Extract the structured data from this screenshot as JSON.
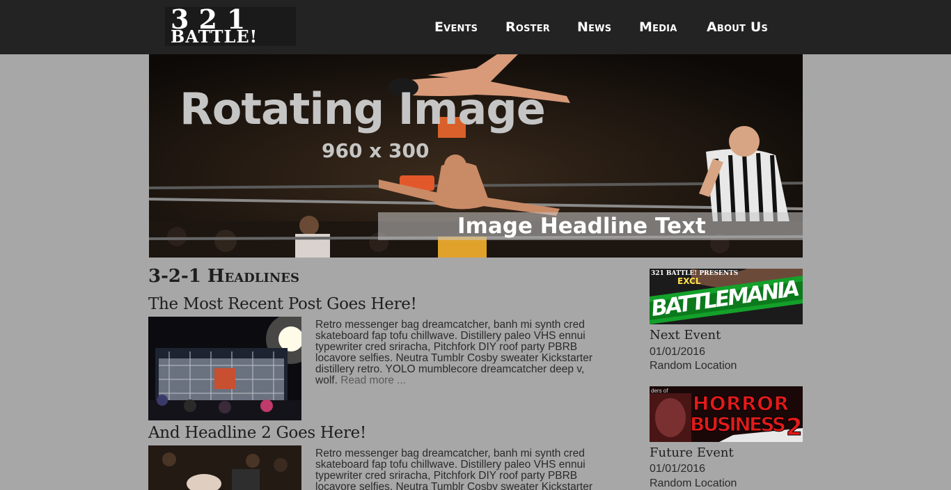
{
  "logo": {
    "line1": "321",
    "line2": "BATTLE!"
  },
  "nav": {
    "items": [
      "Events",
      "Roster",
      "News",
      "Media",
      "About Us"
    ]
  },
  "hero": {
    "title": "Rotating Image",
    "size_text": "960 x 300",
    "caption": "Image Headline Text"
  },
  "headlines": {
    "section_title": "3-2-1 Headlines",
    "posts": [
      {
        "title": "The Most Recent Post Goes Here!",
        "excerpt": "Retro messenger bag dreamcatcher, banh mi synth cred skateboard fap tofu chillwave. Distillery paleo VHS ennui typewriter cred sriracha, Pitchfork DIY roof party PBRB locavore selfies. Neutra Tumblr Cosby sweater Kickstarter distillery retro. YOLO mumblecore dreamcatcher deep v, wolf.",
        "read_more": "Read more ..."
      },
      {
        "title": "And Headline 2 Goes Here!",
        "excerpt": "Retro messenger bag dreamcatcher, banh mi synth cred skateboard fap tofu chillwave. Distillery paleo VHS ennui typewriter cred sriracha, Pitchfork DIY roof party PBRB locavore selfies. Neutra Tumblr Cosby sweater Kickstarter"
      }
    ]
  },
  "sidebar": {
    "events": [
      {
        "banner": {
          "top_left": "321 BATTLE! PRESENTS",
          "badge": "EXCL",
          "name": "BATTLEMANIA"
        },
        "label": "Next Event",
        "date": "01/01/2016",
        "location": "Random Location"
      },
      {
        "banner": {
          "top_left": "ders of",
          "name_line1": "HORROR",
          "name_line2": "BUSINESS",
          "number": "2"
        },
        "label": "Future Event",
        "date": "01/01/2016",
        "location": "Random Location"
      }
    ]
  }
}
